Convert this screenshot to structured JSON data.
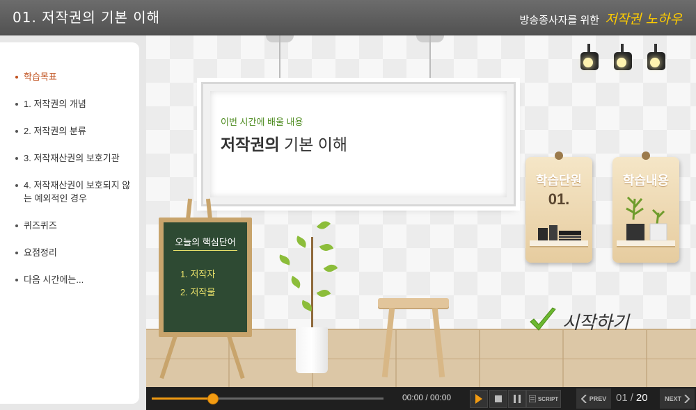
{
  "header": {
    "lesson_title": "01. 저작권의 기본 이해",
    "subtitle_prefix": "방송종사자를 위한",
    "subtitle_highlight": "저작권 노하우"
  },
  "sidebar": {
    "items": [
      {
        "label": "학습목표",
        "active": true
      },
      {
        "label": "1. 저작권의 개념"
      },
      {
        "label": "2. 저작권의 분류"
      },
      {
        "label": "3. 저작재산권의 보호기관"
      },
      {
        "label": "4. 저작재산권이 보호되지 않는 예외적인 경우"
      },
      {
        "label": "퀴즈퀴즈"
      },
      {
        "label": "요점정리"
      },
      {
        "label": "다음 시간에는..."
      }
    ]
  },
  "board": {
    "caption": "이번 시간에 배울 내용",
    "title_bold": "저작권의",
    "title_rest": " 기본 이해"
  },
  "chalkboard": {
    "title": "오늘의 핵심단어",
    "items": [
      "1. 저작자",
      "2. 저작물"
    ]
  },
  "tags": {
    "unit": {
      "title": "학습단원",
      "number": "01."
    },
    "content": {
      "title": "학습내용"
    }
  },
  "start": {
    "label": "시작하기"
  },
  "player": {
    "time": "00:00 / 00:00",
    "progress": 0.26,
    "script_label": "SCRIPT",
    "prev_label": "PREV",
    "next_label": "NEXT",
    "page_current": "01",
    "page_separator": "/",
    "page_total": "20"
  },
  "colors": {
    "accent": "#f29b12",
    "active_menu": "#c0501d",
    "chalkboard": "#2e4a33",
    "highlight": "#ffcc00"
  }
}
